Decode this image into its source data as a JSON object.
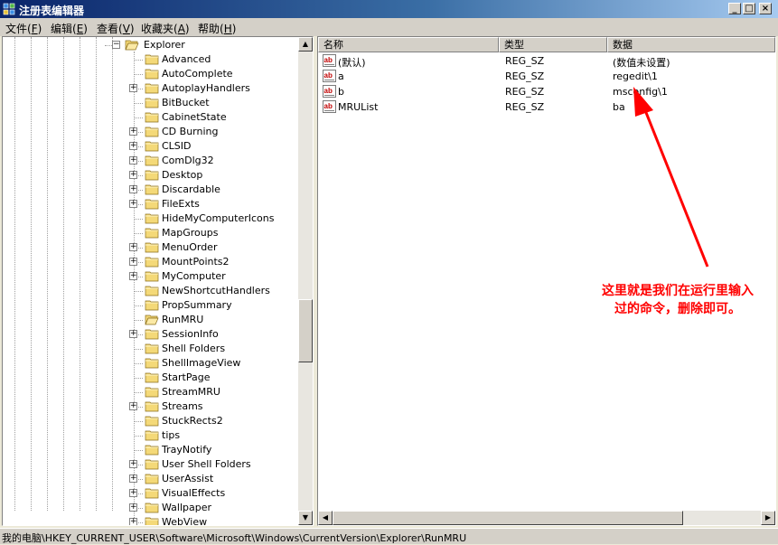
{
  "window": {
    "title": "注册表编辑器",
    "minimize": "_",
    "maximize": "□",
    "close": "×"
  },
  "menu": [
    {
      "label": "文件(",
      "key": "F",
      "end": ")"
    },
    {
      "label": "编辑(",
      "key": "E",
      "end": ")"
    },
    {
      "label": "查看(",
      "key": "V",
      "end": ")"
    },
    {
      "label": "收藏夹(",
      "key": "A",
      "end": ")"
    },
    {
      "label": "帮助(",
      "key": "H",
      "end": ")"
    }
  ],
  "tree": {
    "parent": {
      "label": "Explorer",
      "expander": "−"
    },
    "items": [
      {
        "label": "Advanced",
        "expandable": false
      },
      {
        "label": "AutoComplete",
        "expandable": false
      },
      {
        "label": "AutoplayHandlers",
        "expandable": true
      },
      {
        "label": "BitBucket",
        "expandable": false
      },
      {
        "label": "CabinetState",
        "expandable": false
      },
      {
        "label": "CD Burning",
        "expandable": true
      },
      {
        "label": "CLSID",
        "expandable": true
      },
      {
        "label": "ComDlg32",
        "expandable": true
      },
      {
        "label": "Desktop",
        "expandable": true
      },
      {
        "label": "Discardable",
        "expandable": true
      },
      {
        "label": "FileExts",
        "expandable": true
      },
      {
        "label": "HideMyComputerIcons",
        "expandable": false
      },
      {
        "label": "MapGroups",
        "expandable": false
      },
      {
        "label": "MenuOrder",
        "expandable": true
      },
      {
        "label": "MountPoints2",
        "expandable": true
      },
      {
        "label": "MyComputer",
        "expandable": true
      },
      {
        "label": "NewShortcutHandlers",
        "expandable": false
      },
      {
        "label": "PropSummary",
        "expandable": false
      },
      {
        "label": "RunMRU",
        "expandable": false,
        "selected": true
      },
      {
        "label": "SessionInfo",
        "expandable": true
      },
      {
        "label": "Shell Folders",
        "expandable": false
      },
      {
        "label": "ShellImageView",
        "expandable": false
      },
      {
        "label": "StartPage",
        "expandable": false
      },
      {
        "label": "StreamMRU",
        "expandable": false
      },
      {
        "label": "Streams",
        "expandable": true
      },
      {
        "label": "StuckRects2",
        "expandable": false
      },
      {
        "label": "tips",
        "expandable": false
      },
      {
        "label": "TrayNotify",
        "expandable": false
      },
      {
        "label": "User Shell Folders",
        "expandable": true
      },
      {
        "label": "UserAssist",
        "expandable": true
      },
      {
        "label": "VisualEffects",
        "expandable": true
      },
      {
        "label": "Wallpaper",
        "expandable": true
      },
      {
        "label": "WebView",
        "expandable": true
      }
    ],
    "expand_glyph": "+"
  },
  "list": {
    "headers": {
      "name": "名称",
      "type": "类型",
      "data": "数据"
    },
    "rows": [
      {
        "name": "(默认)",
        "type": "REG_SZ",
        "data": "(数值未设置)"
      },
      {
        "name": "a",
        "type": "REG_SZ",
        "data": "regedit\\1"
      },
      {
        "name": "b",
        "type": "REG_SZ",
        "data": "msconfig\\1"
      },
      {
        "name": "MRUList",
        "type": "REG_SZ",
        "data": "ba"
      }
    ],
    "icon_text": "ab"
  },
  "scroll": {
    "up": "▲",
    "down": "▼",
    "left": "◀",
    "right": "▶"
  },
  "status": {
    "path": "我的电脑\\HKEY_CURRENT_USER\\Software\\Microsoft\\Windows\\CurrentVersion\\Explorer\\RunMRU"
  },
  "annotation": {
    "line1": "这里就是我们在运行里输入",
    "line2": "过的命令，删除即可。"
  },
  "colors": {
    "annotation": "#ff0000",
    "title_start": "#0a246a",
    "title_end": "#a6caf0"
  }
}
